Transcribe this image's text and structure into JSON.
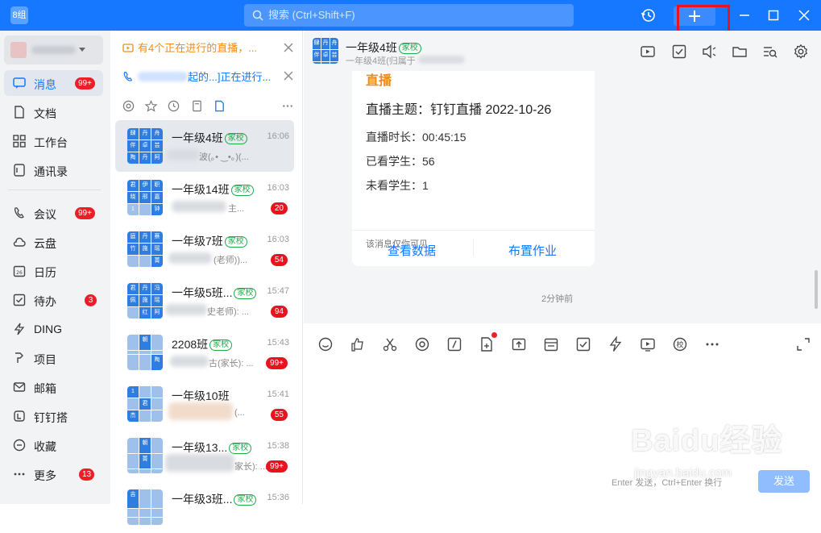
{
  "titlebar": {
    "logo_text": "8组",
    "search_placeholder": "搜索 (Ctrl+Shift+F)",
    "accent": "#1677ff"
  },
  "sidebar": {
    "items": [
      {
        "label": "消息",
        "icon": "message-icon",
        "badge": "99+",
        "active": true
      },
      {
        "label": "文档",
        "icon": "document-icon"
      },
      {
        "label": "工作台",
        "icon": "workbench-icon"
      },
      {
        "label": "通讯录",
        "icon": "contacts-icon"
      },
      {
        "label": "会议",
        "icon": "meeting-icon",
        "badge": "99+"
      },
      {
        "label": "云盘",
        "icon": "cloud-icon"
      },
      {
        "label": "日历",
        "icon": "calendar-icon"
      },
      {
        "label": "待办",
        "icon": "todo-icon",
        "badge": "3"
      },
      {
        "label": "DING",
        "icon": "ding-icon"
      },
      {
        "label": "项目",
        "icon": "project-icon"
      },
      {
        "label": "邮箱",
        "icon": "mail-icon"
      },
      {
        "label": "钉钉搭",
        "icon": "builder-icon"
      },
      {
        "label": "收藏",
        "icon": "favorites-icon"
      },
      {
        "label": "更多",
        "icon": "more-icon",
        "badge": "13"
      }
    ]
  },
  "list": {
    "live_notice": "有4个正在进行的直播，...",
    "call_notice": "起的...]正在进行...",
    "chats": [
      {
        "name": "一年级4班",
        "tag": "家校",
        "time": "16:06",
        "preview": "波(｡• ‿•｡)(...",
        "badge": "",
        "avatar": [
          "肆",
          "丹",
          "舟",
          "伴",
          "卓",
          "芸",
          "陶",
          "丹",
          "阿"
        ]
      },
      {
        "name": "一年级14班",
        "tag": "家校",
        "time": "16:03",
        "preview": "主...",
        "badge": "20",
        "avatar": [
          "君",
          "伊",
          "职",
          "晓",
          "邢",
          "嘉",
          "1",
          "",
          "钟"
        ]
      },
      {
        "name": "一年级7班",
        "tag": "家校",
        "time": "16:03",
        "preview": "(老师))...",
        "badge": "54",
        "avatar": [
          "庭",
          "丹",
          "蔡",
          "竹",
          "施",
          "瑶",
          "",
          "",
          "菁"
        ]
      },
      {
        "name": "一年级5班...",
        "tag": "家校",
        "time": "15:47",
        "preview": "史老师): ...",
        "badge": "94",
        "avatar": [
          "君",
          "丹",
          "冯",
          "佩",
          "施",
          "瑶",
          "",
          "红",
          "阿"
        ]
      },
      {
        "name": "2208班",
        "tag": "家校",
        "time": "15:43",
        "preview": "古(家长): ...",
        "badge": "99+",
        "avatar": [
          "",
          "朝",
          "",
          "",
          "",
          "",
          "",
          "",
          "陶"
        ]
      },
      {
        "name": "一年级10班",
        "tag": "家校",
        "time": "15:41",
        "preview": "(...",
        "badge": "55",
        "avatar": [
          "1",
          "",
          "",
          "",
          "君",
          "",
          "杰",
          "",
          ""
        ]
      },
      {
        "name": "一年级13...",
        "tag": "家校",
        "time": "15:38",
        "preview": "家长): ...",
        "badge": "99+",
        "avatar": [
          "",
          "朝",
          "",
          "",
          "菁",
          "",
          "",
          "",
          ""
        ]
      },
      {
        "name": "一年级3班...",
        "tag": "家校",
        "time": "15:36",
        "preview": "",
        "badge": "",
        "avatar": [
          "吉",
          "",
          "",
          "",
          "",
          "",
          "",
          "",
          ""
        ]
      }
    ]
  },
  "chat": {
    "title": "一年级4班",
    "tag": "家校",
    "subtitle": "一年级4班(归属于",
    "card": {
      "heading": "直播",
      "topic": "直播主题：钉钉直播 2022-10-26",
      "duration": "直播时长：00:45:15",
      "watched": "已看学生：56",
      "unwatched": "未看学生：1",
      "note": "该消息仅你可见",
      "action_data": "查看数据",
      "action_homework": "布置作业"
    },
    "timestamp": "2分钟前",
    "input": {
      "hint": "Enter 发送，Ctrl+Enter 换行",
      "send_label": "发送"
    }
  },
  "watermark": {
    "main": "Baidu经验",
    "sub": "jingyan.baidu.com"
  }
}
